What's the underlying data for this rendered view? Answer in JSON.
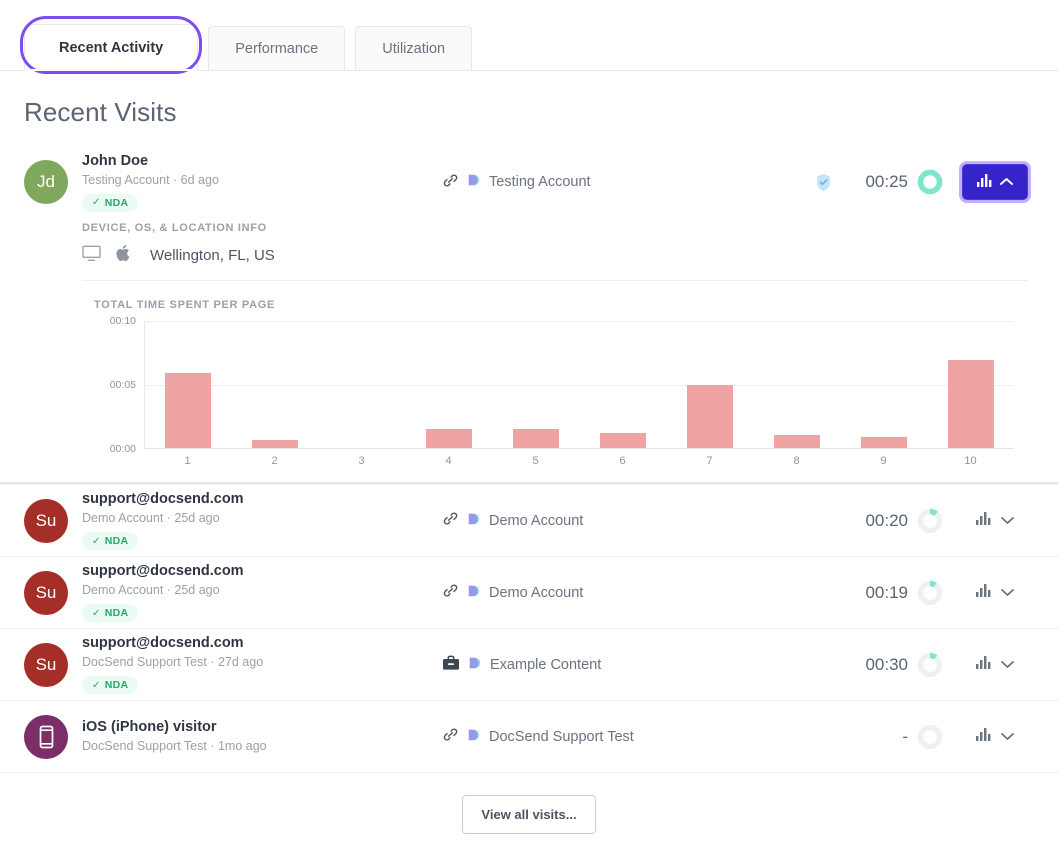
{
  "tabs": [
    {
      "label": "Recent Activity",
      "active": true
    },
    {
      "label": "Performance",
      "active": false
    },
    {
      "label": "Utilization",
      "active": false
    }
  ],
  "page_title": "Recent Visits",
  "colors": {
    "accent_purple": "#7c4df0",
    "button_indigo": "#3524c9",
    "bar_pink": "#efa3a3",
    "donut_teal": "#7fe6cd",
    "nda_green": "#2fa36b",
    "avatar_green": "#7fa85c",
    "avatar_red": "#a32f28",
    "avatar_purple": "#7b2f66"
  },
  "visits": [
    {
      "avatar_initials": "Jd",
      "avatar_type": "initials",
      "avatar_color": "#7fa85c",
      "name": "John Doe",
      "sub": "Testing Account · 6d ago",
      "nda": "NDA",
      "nda_check": "✓",
      "source_icon": "link-icon",
      "doc_icon": "docsend-logo-icon",
      "source_label": "Testing Account",
      "verified": true,
      "duration": "00:25",
      "completion_pct": 100,
      "expanded": true,
      "expand_icon": "chevron-up-icon"
    },
    {
      "avatar_initials": "Su",
      "avatar_type": "initials",
      "avatar_color": "#a32f28",
      "name": "support@docsend.com",
      "sub": "Demo Account · 25d ago",
      "nda": "NDA",
      "nda_check": "✓",
      "source_icon": "link-icon",
      "doc_icon": "docsend-logo-icon",
      "source_label": "Demo Account",
      "verified": false,
      "duration": "00:20",
      "completion_pct": 11,
      "expanded": false,
      "expand_icon": "chevron-down-icon"
    },
    {
      "avatar_initials": "Su",
      "avatar_type": "initials",
      "avatar_color": "#a32f28",
      "name": "support@docsend.com",
      "sub": "Demo Account · 25d ago",
      "nda": "NDA",
      "nda_check": "✓",
      "source_icon": "link-icon",
      "doc_icon": "docsend-logo-icon",
      "source_label": "Demo Account",
      "verified": false,
      "duration": "00:19",
      "completion_pct": 9,
      "expanded": false,
      "expand_icon": "chevron-down-icon"
    },
    {
      "avatar_initials": "Su",
      "avatar_type": "initials",
      "avatar_color": "#a32f28",
      "name": "support@docsend.com",
      "sub": "DocSend Support Test · 27d ago",
      "nda": "NDA",
      "nda_check": "✓",
      "source_icon": "briefcase-icon",
      "doc_icon": "docsend-logo-icon",
      "source_label": "Example Content",
      "verified": false,
      "duration": "00:30",
      "completion_pct": 10,
      "expanded": false,
      "expand_icon": "chevron-down-icon"
    },
    {
      "avatar_initials": "",
      "avatar_type": "phone-icon",
      "avatar_color": "#7b2f66",
      "name": "iOS (iPhone) visitor",
      "sub": "DocSend Support Test · 1mo ago",
      "nda": null,
      "nda_check": "",
      "source_icon": "link-icon",
      "doc_icon": "docsend-logo-icon",
      "source_label": "DocSend Support Test",
      "verified": false,
      "duration": "-",
      "completion_pct": 0,
      "expanded": false,
      "expand_icon": "chevron-down-icon"
    }
  ],
  "detail": {
    "device_heading": "DEVICE, OS, & LOCATION INFO",
    "device_icon": "desktop-monitor-icon",
    "os_icon": "apple-logo-icon",
    "location": "Wellington, FL, US"
  },
  "chart_data": {
    "type": "bar",
    "title": "TOTAL TIME SPENT PER PAGE",
    "xlabel": "",
    "ylabel": "",
    "categories": [
      "1",
      "2",
      "3",
      "4",
      "5",
      "6",
      "7",
      "8",
      "9",
      "10"
    ],
    "values": [
      5.9,
      0.6,
      0.0,
      1.5,
      1.5,
      1.2,
      5.0,
      1.0,
      0.9,
      6.9
    ],
    "ytick_labels": [
      "00:00",
      "00:05",
      "00:10"
    ],
    "ytick_values": [
      0,
      5,
      10
    ],
    "ylim": [
      0,
      10
    ],
    "grid": true,
    "legend": "none",
    "series_color": "#efa3a3"
  },
  "footer": {
    "view_all_label": "View all visits..."
  }
}
